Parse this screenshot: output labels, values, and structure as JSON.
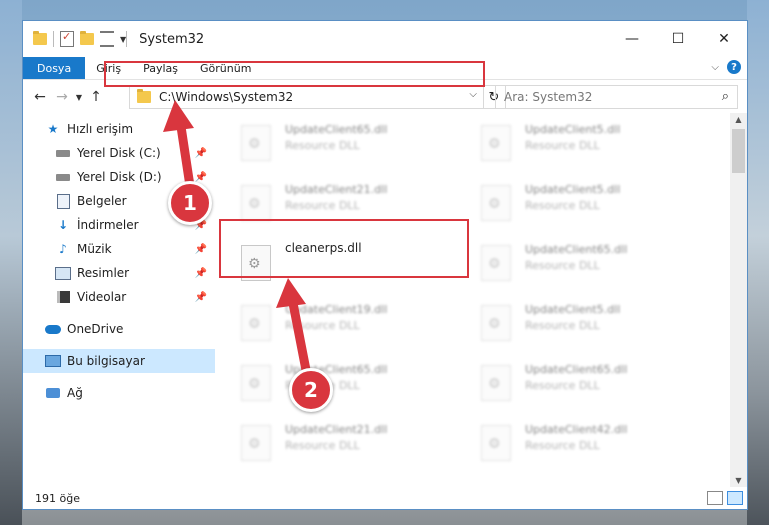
{
  "window": {
    "title": "System32",
    "controls": {
      "minimize": "—",
      "maximize": "☐",
      "close": "✕"
    }
  },
  "ribbon": {
    "tabs": [
      "Dosya",
      "Giriş",
      "Paylaş",
      "Görünüm"
    ],
    "help": "?"
  },
  "address": {
    "path": "C:\\Windows\\System32",
    "search_placeholder": "Ara: System32"
  },
  "nav": {
    "items": [
      {
        "label": "Hızlı erişim",
        "icon": "star-icon",
        "pinned": false
      },
      {
        "label": "Yerel Disk (C:)",
        "icon": "drive-icon",
        "pinned": true
      },
      {
        "label": "Yerel Disk (D:)",
        "icon": "drive-icon",
        "pinned": true
      },
      {
        "label": "Belgeler",
        "icon": "documents-icon",
        "pinned": true
      },
      {
        "label": "İndirmeler",
        "icon": "downloads-icon",
        "pinned": true
      },
      {
        "label": "Müzik",
        "icon": "music-icon",
        "pinned": true
      },
      {
        "label": "Resimler",
        "icon": "pictures-icon",
        "pinned": true
      },
      {
        "label": "Videolar",
        "icon": "videos-icon",
        "pinned": true
      },
      {
        "label": "OneDrive",
        "icon": "cloud-icon",
        "pinned": false
      },
      {
        "label": "Bu bilgisayar",
        "icon": "computer-icon",
        "pinned": false,
        "selected": true
      },
      {
        "label": "Ağ",
        "icon": "network-icon",
        "pinned": false
      }
    ]
  },
  "files": [
    {
      "name": "UpdateClient65.dll",
      "type": "Resource DLL",
      "blurred": true
    },
    {
      "name": "UpdateClient5.dll",
      "type": "Resource DLL",
      "blurred": true
    },
    {
      "name": "UpdateClient21.dll",
      "type": "Resource DLL",
      "blurred": true
    },
    {
      "name": "UpdateClient5.dll",
      "type": "Resource DLL",
      "blurred": true
    },
    {
      "name": "cleanerps.dll",
      "type": "",
      "blurred": false
    },
    {
      "name": "UpdateClient65.dll",
      "type": "Resource DLL",
      "blurred": true
    },
    {
      "name": "UpdateClient19.dll",
      "type": "Resource DLL",
      "blurred": true
    },
    {
      "name": "UpdateClient5.dll",
      "type": "Resource DLL",
      "blurred": true
    },
    {
      "name": "UpdateClient65.dll",
      "type": "Resource DLL",
      "blurred": true
    },
    {
      "name": "UpdateClient65.dll",
      "type": "Resource DLL",
      "blurred": true
    },
    {
      "name": "UpdateClient21.dll",
      "type": "Resource DLL",
      "blurred": true
    },
    {
      "name": "UpdateClient42.dll",
      "type": "Resource DLL",
      "blurred": true
    }
  ],
  "status": {
    "count": "191 öğe"
  },
  "annotations": {
    "step1": "1",
    "step2": "2",
    "highlight_color": "#d9363e"
  },
  "colors": {
    "accent": "#1979ca",
    "selection": "#cce8ff"
  }
}
